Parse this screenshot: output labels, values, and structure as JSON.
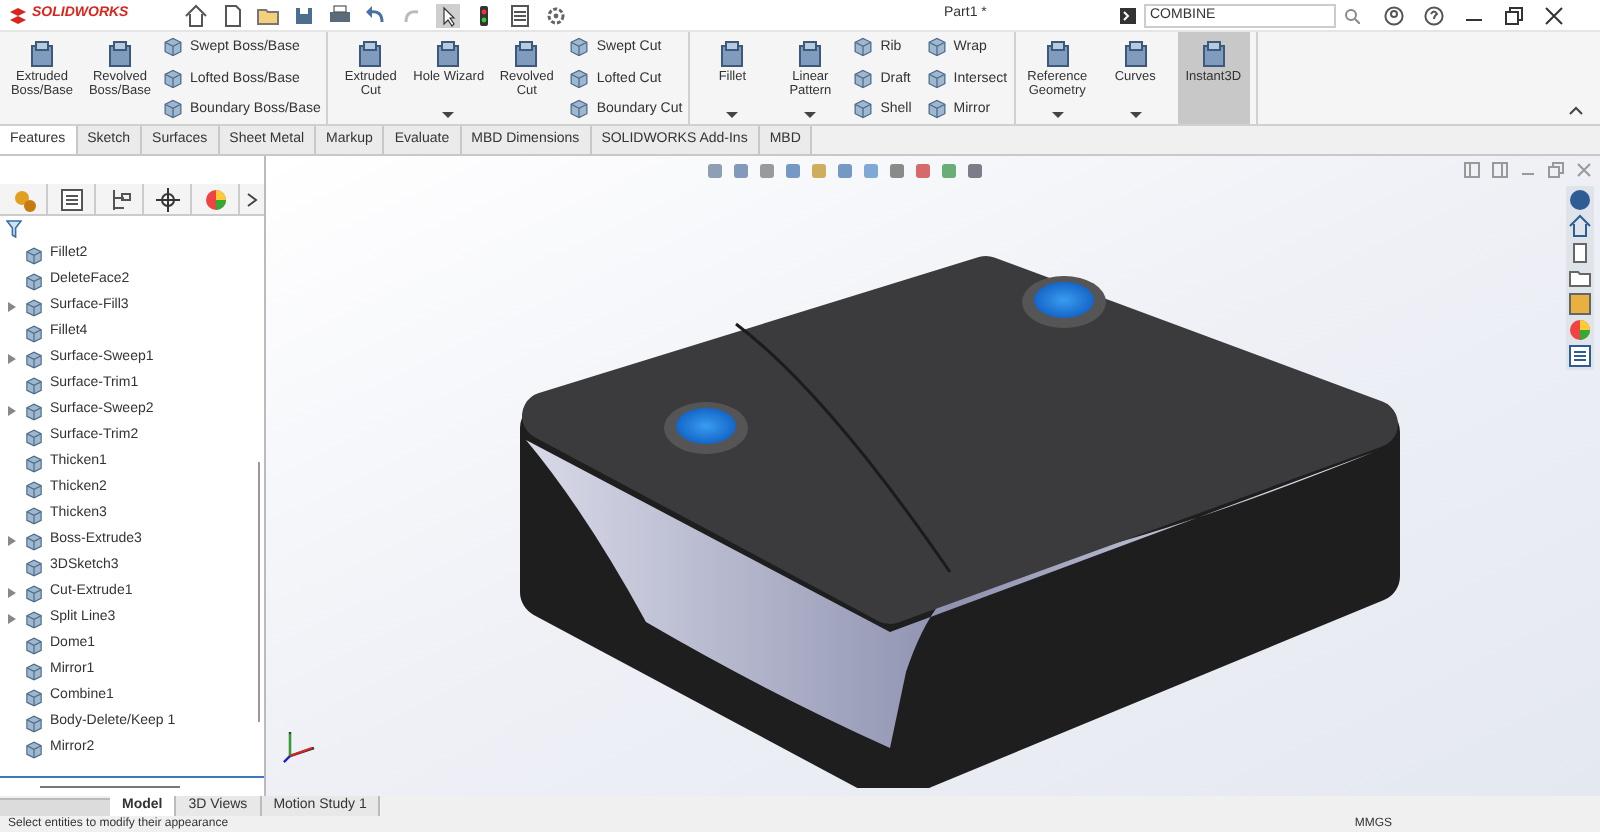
{
  "app": {
    "logo": "SOLIDWORKS",
    "document_title": "Part1 *",
    "search": {
      "value": "COMBINE"
    }
  },
  "ribbon": {
    "groups": [
      {
        "items": [
          {
            "kind": "large",
            "label": "Extruded Boss/Base",
            "dropdown": false,
            "selected": false
          },
          {
            "kind": "large",
            "label": "Revolved Boss/Base",
            "dropdown": false,
            "selected": false
          }
        ],
        "stack": [
          "Swept Boss/Base",
          "Lofted Boss/Base",
          "Boundary Boss/Base"
        ]
      },
      {
        "items": [
          {
            "kind": "large",
            "label": "Extruded Cut",
            "dropdown": false,
            "selected": false
          },
          {
            "kind": "large",
            "label": "Hole Wizard",
            "dropdown": true,
            "selected": false
          },
          {
            "kind": "large",
            "label": "Revolved Cut",
            "dropdown": false,
            "selected": false
          }
        ],
        "stack": [
          "Swept Cut",
          "Lofted Cut",
          "Boundary Cut"
        ]
      },
      {
        "items": [
          {
            "kind": "large",
            "label": "Fillet",
            "dropdown": true,
            "selected": false
          },
          {
            "kind": "large",
            "label": "Linear Pattern",
            "dropdown": true,
            "selected": false
          }
        ],
        "stack": [
          "Rib",
          "Draft",
          "Shell"
        ],
        "stack2": [
          "Wrap",
          "Intersect",
          "Mirror"
        ]
      },
      {
        "items": [
          {
            "kind": "large",
            "label": "Reference Geometry",
            "dropdown": true,
            "selected": false
          },
          {
            "kind": "large",
            "label": "Curves",
            "dropdown": true,
            "selected": false
          },
          {
            "kind": "large",
            "label": "Instant3D",
            "dropdown": false,
            "selected": true
          }
        ]
      }
    ]
  },
  "command_tabs": [
    {
      "label": "Features",
      "selected": true
    },
    {
      "label": "Sketch",
      "selected": false
    },
    {
      "label": "Surfaces",
      "selected": false
    },
    {
      "label": "Sheet Metal",
      "selected": false
    },
    {
      "label": "Markup",
      "selected": false
    },
    {
      "label": "Evaluate",
      "selected": false
    },
    {
      "label": "MBD Dimensions",
      "selected": false
    },
    {
      "label": "SOLIDWORKS Add-Ins",
      "selected": false
    },
    {
      "label": "MBD",
      "selected": false
    }
  ],
  "feature_tree": [
    {
      "label": "Fillet2",
      "expandable": false
    },
    {
      "label": "DeleteFace2",
      "expandable": false
    },
    {
      "label": "Surface-Fill3",
      "expandable": true
    },
    {
      "label": "Fillet4",
      "expandable": false
    },
    {
      "label": "Surface-Sweep1",
      "expandable": true
    },
    {
      "label": "Surface-Trim1",
      "expandable": false
    },
    {
      "label": "Surface-Sweep2",
      "expandable": true
    },
    {
      "label": "Surface-Trim2",
      "expandable": false
    },
    {
      "label": "Thicken1",
      "expandable": false
    },
    {
      "label": "Thicken2",
      "expandable": false
    },
    {
      "label": "Thicken3",
      "expandable": false
    },
    {
      "label": "Boss-Extrude3",
      "expandable": true
    },
    {
      "label": "3DSketch3",
      "expandable": false
    },
    {
      "label": "Cut-Extrude1",
      "expandable": true
    },
    {
      "label": "Split Line3",
      "expandable": true
    },
    {
      "label": "Dome1",
      "expandable": false
    },
    {
      "label": "Mirror1",
      "expandable": false
    },
    {
      "label": "Combine1",
      "expandable": false
    },
    {
      "label": "Body-Delete/Keep 1",
      "expandable": false
    },
    {
      "label": "Mirror2",
      "expandable": false
    }
  ],
  "bottom_tabs": [
    {
      "label": "Model",
      "selected": true
    },
    {
      "label": "3D Views",
      "selected": false
    },
    {
      "label": "Motion Study 1",
      "selected": false
    }
  ],
  "status_bar": {
    "message": "Select entities to modify their appearance",
    "units": "MMGS"
  }
}
